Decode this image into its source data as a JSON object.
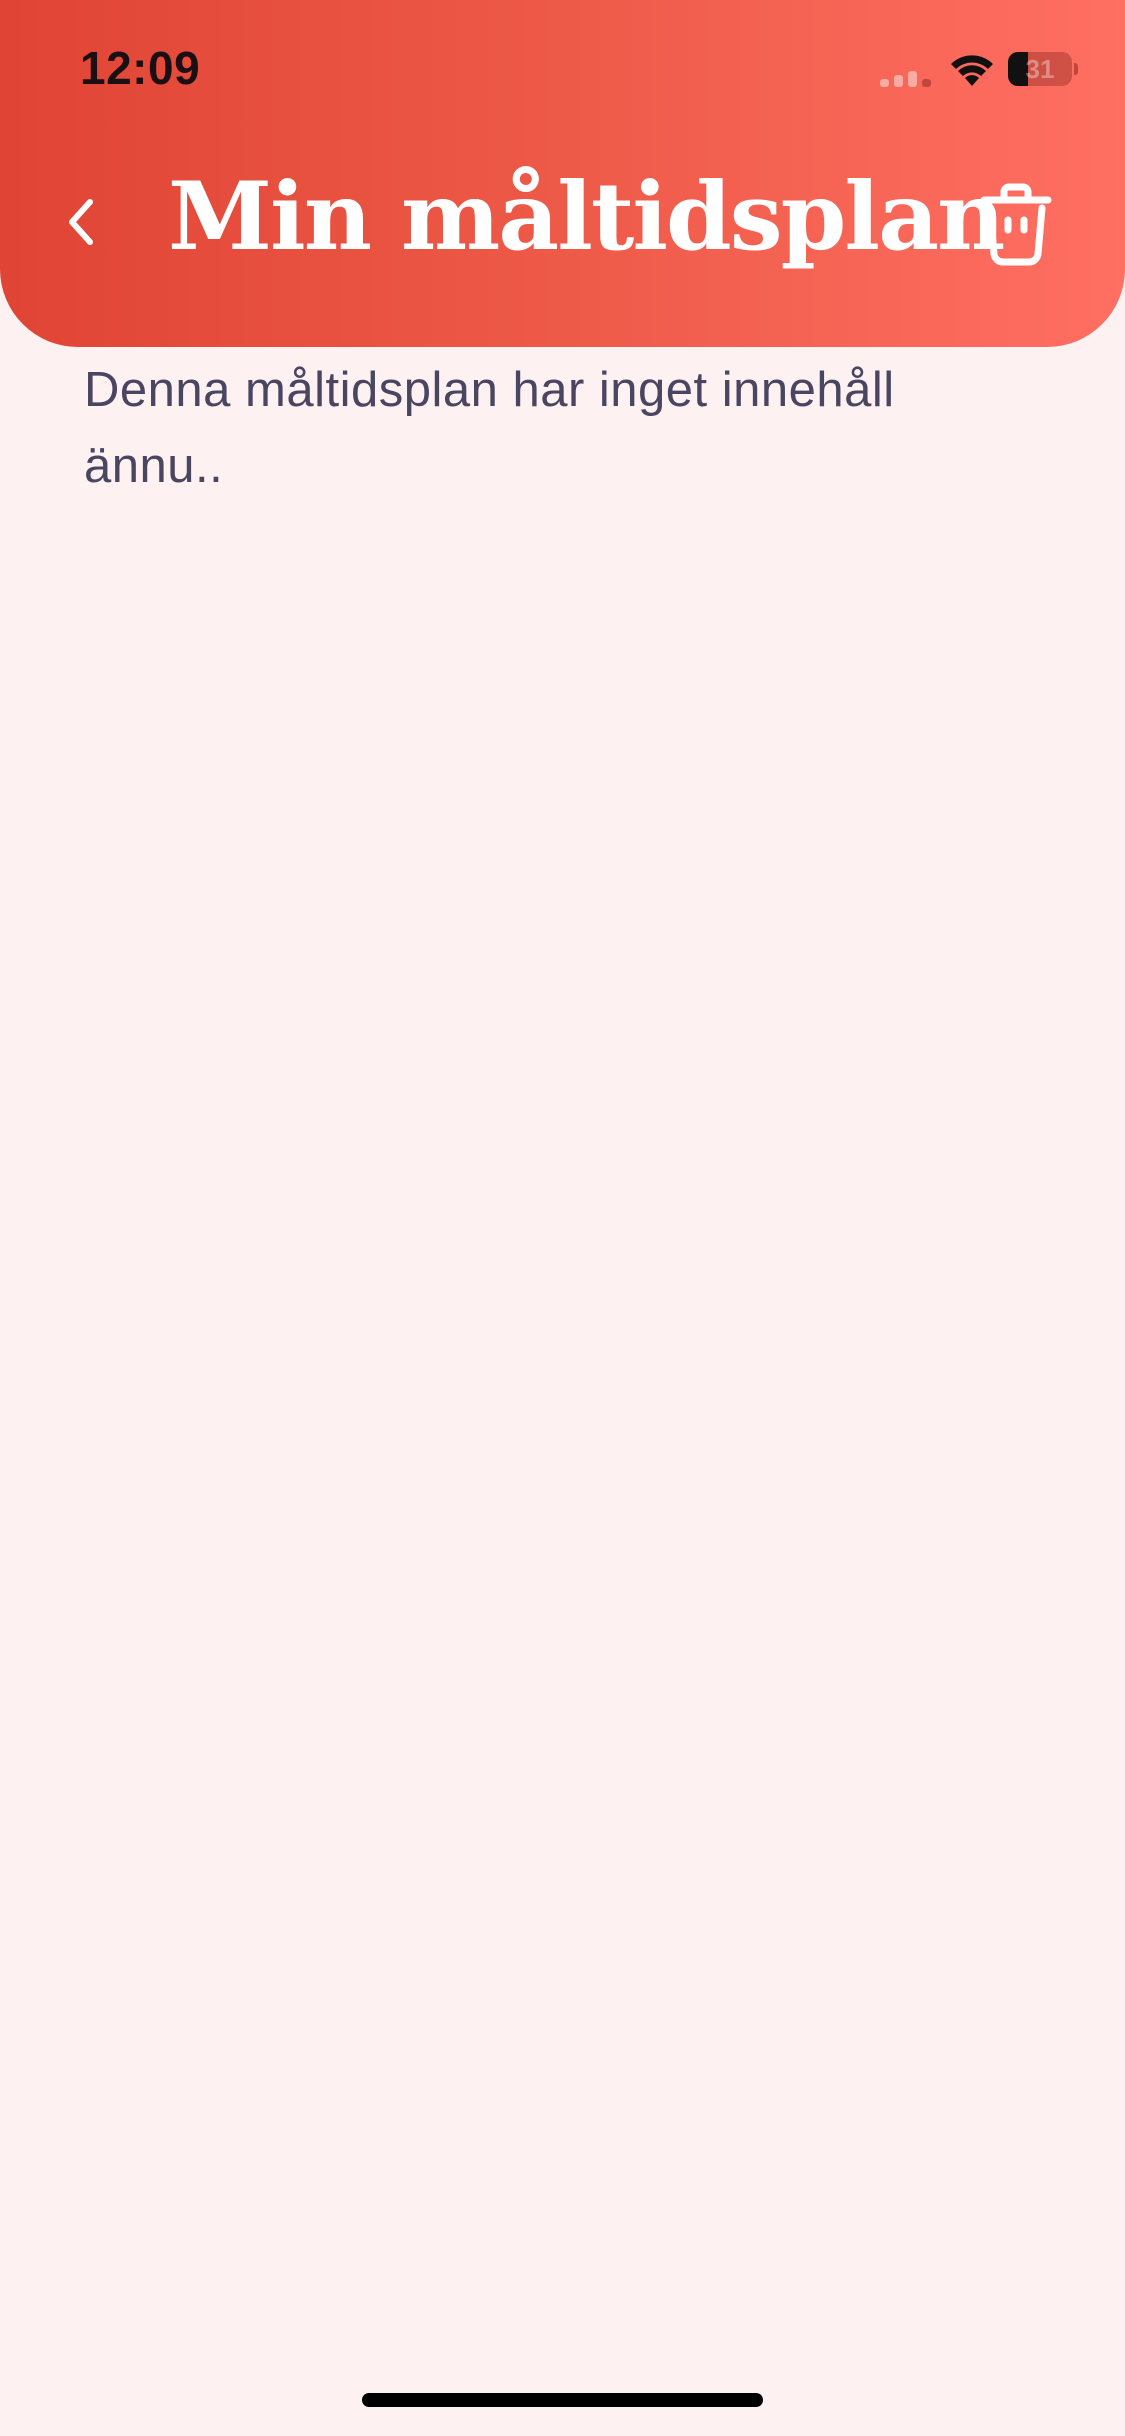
{
  "status_bar": {
    "time": "12:09",
    "battery_percent": "31",
    "battery_level": 0.31,
    "signal_icon": "cellular-signal-icon",
    "wifi_icon": "wifi-icon",
    "battery_icon": "battery-icon"
  },
  "header": {
    "title": "Min måltidsplan",
    "back_icon": "chevron-left-icon",
    "delete_icon": "trash-icon",
    "gradient_start": "#e04434",
    "gradient_end": "#ff6f62"
  },
  "content": {
    "empty_message": "Denna måltidsplan har inget innehåll ännu.."
  },
  "colors": {
    "background": "#fdf1f1",
    "text": "#4a4560"
  }
}
